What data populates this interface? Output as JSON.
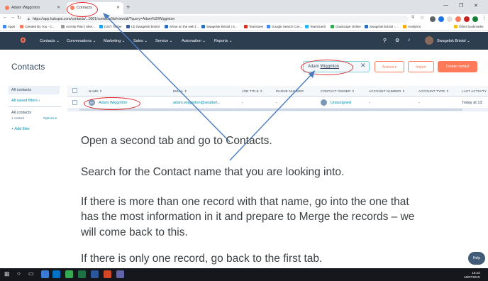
{
  "browser": {
    "tabs": [
      {
        "label": "Adam Wigginton"
      },
      {
        "label": "Contacts"
      }
    ],
    "url": "https://app.hubspot.com/contacts/...0001/contacts/list/view/all/?query=Adam%20Wigginton",
    "bookmarks": [
      "Apps",
      "Created By You - C...",
      "Activity Plan | Sket...",
      "(157) Twitter",
      "(4) Swagelok Bristol",
      "Shine on the web |...",
      "Swagelok Bristol | S...",
      "TeamSeer",
      "Google Search Con...",
      "TeamGantt",
      "Goalscape Online",
      "Swagelok Bristol -...",
      "Analytics",
      "Other bookmarks"
    ]
  },
  "nav": {
    "items": [
      "Contacts",
      "Conversations",
      "Marketing",
      "Sales",
      "Service",
      "Automation",
      "Reports"
    ],
    "account_name": "Swagelok Bristol"
  },
  "page": {
    "title": "Contacts",
    "search_value_prefix": "Adam ",
    "search_value_underlined": "Wigginton",
    "actions_label": "Actions",
    "import_label": "Import",
    "create_label": "Create contact"
  },
  "sidebar": {
    "all_contacts": "All contacts",
    "all_saved_filters": "All saved filters",
    "list_title": "All contacts",
    "list_count": "1 contact",
    "options": "Options",
    "add_filter": "+ Add filter"
  },
  "table": {
    "columns": [
      "NAME",
      "EMAIL",
      "JOB TITLE",
      "PHONE NUMBER",
      "CONTACT OWNER",
      "ACCOUNT NUMBER",
      "ACCOUNT TYPE",
      "LAST ACTIVITY"
    ],
    "rows": [
      {
        "initials": "AW",
        "name": "Adam Wigginton",
        "email": "adam.wigginton@seatbel...",
        "job_title": "-",
        "phone": "-",
        "owner": "Unassigned",
        "account_number": "-",
        "account_type": "-",
        "last_activity": "Today at 13:"
      }
    ]
  },
  "instructions": [
    "Open a second tab and go to Contacts.",
    "Search for the Contact name that you are looking into.",
    "If there is more than one record with that name, go into the one that",
    "has the most information in it and prepare to Merge the records – we",
    "will come back to this.",
    "If there is only one record, go back to the first tab."
  ],
  "help_label": "Help",
  "clock": {
    "time": "15:23",
    "date": "16/07/2019"
  },
  "colors": {
    "hubspot_nav": "#2d3e50",
    "accent": "#ff7a59",
    "annotation_red": "#e0272d",
    "arrow_blue": "#4a7bbf"
  }
}
